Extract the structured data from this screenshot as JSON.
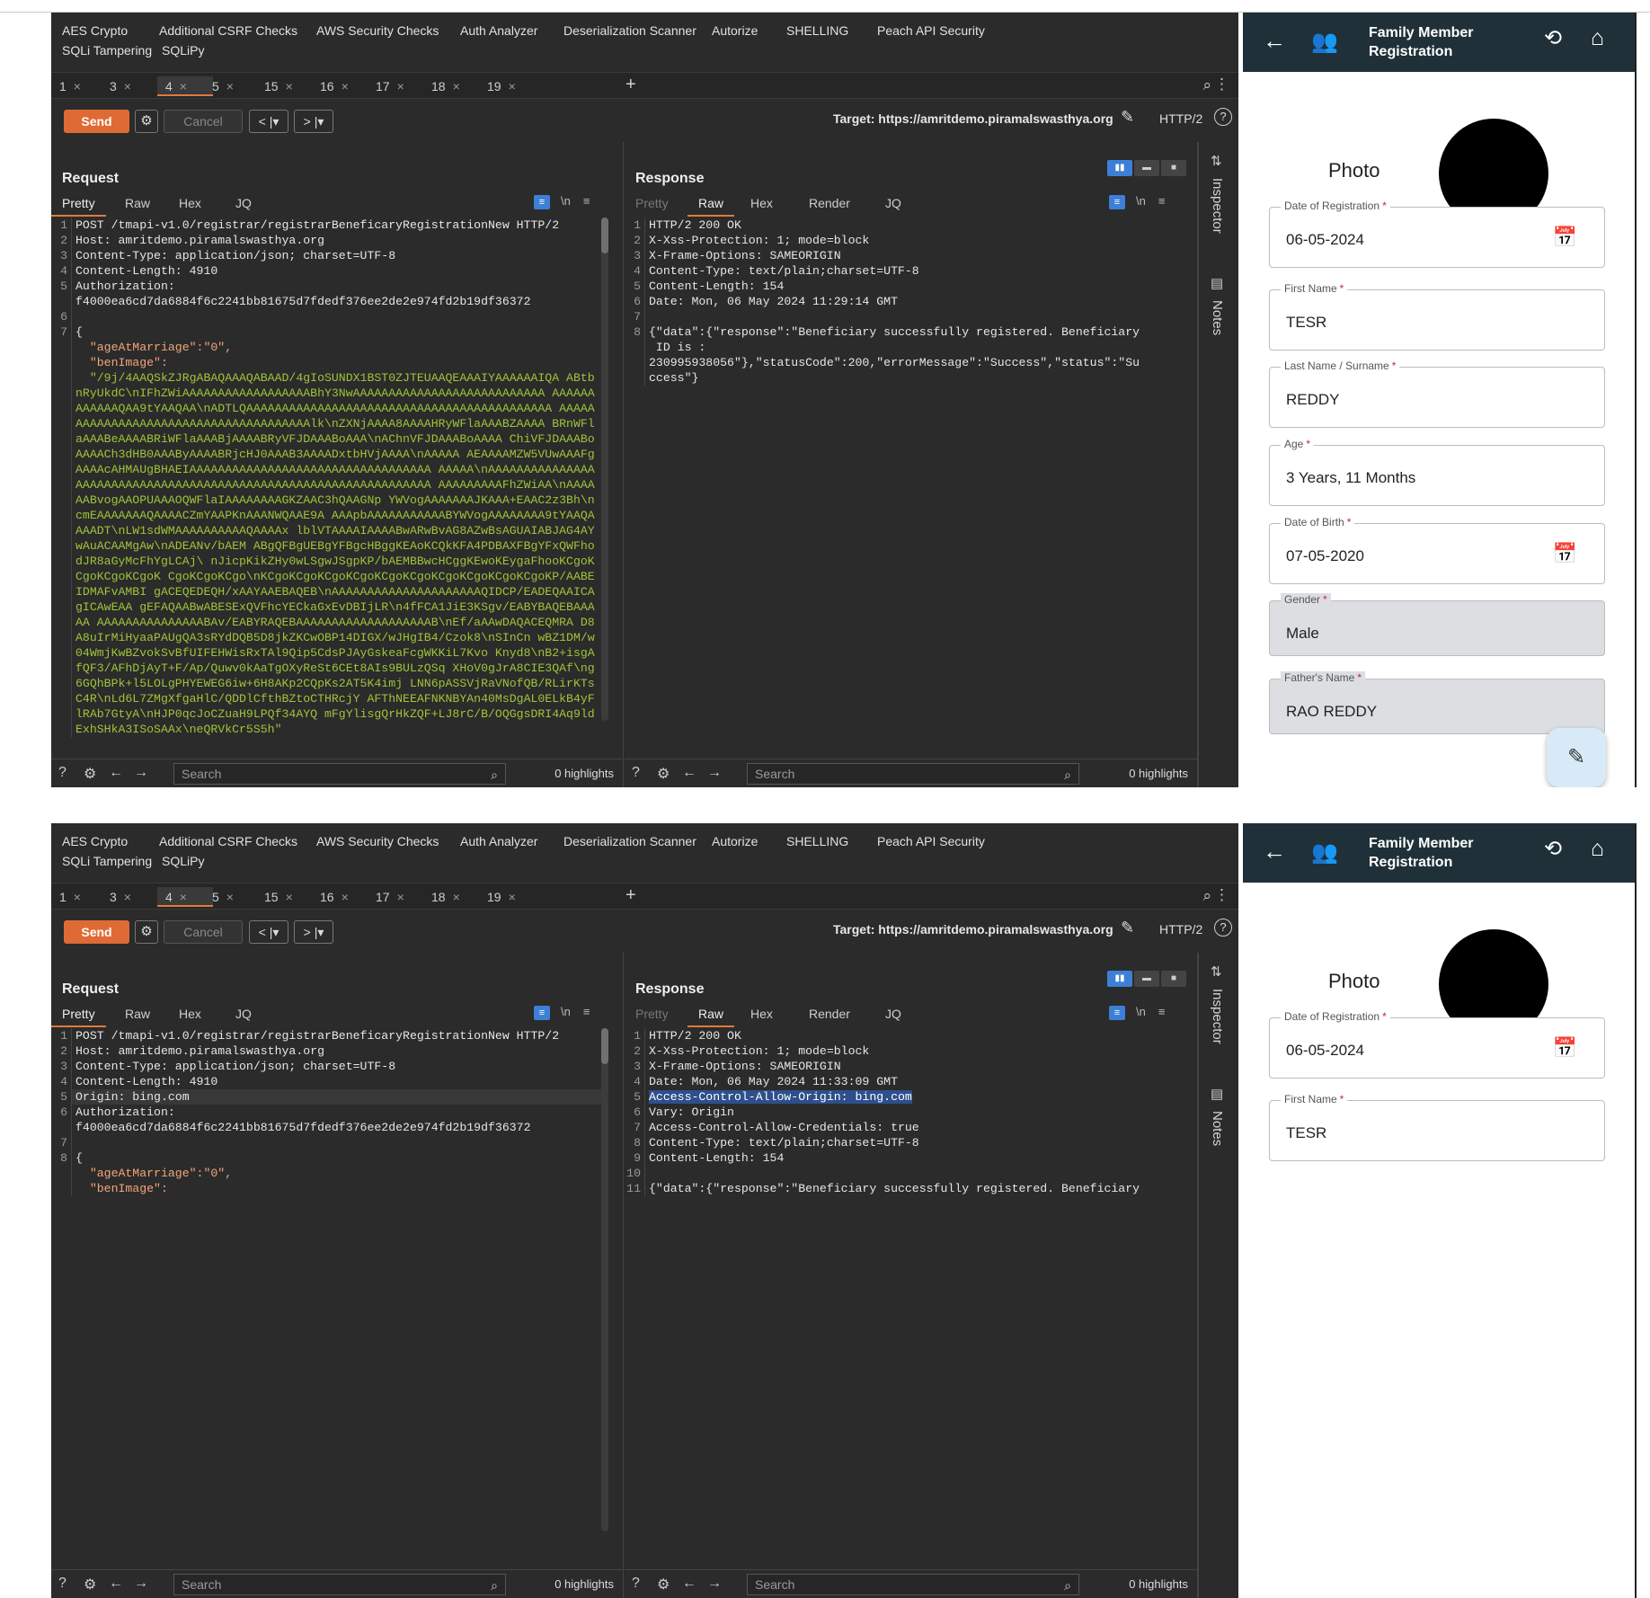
{
  "extensions": [
    "AES Crypto",
    "Additional CSRF Checks",
    "AWS Security Checks",
    "Auth Analyzer",
    "Deserialization Scanner",
    "Autorize",
    "SHELLING",
    "Peach API Security",
    "SQLi Tampering",
    "SQLiPy"
  ],
  "tabs": [
    {
      "label": "1",
      "close": "×"
    },
    {
      "label": "3",
      "close": "×"
    },
    {
      "label": "4",
      "close": "×"
    },
    {
      "label": "5",
      "close": "×"
    },
    {
      "label": "15",
      "close": "×"
    },
    {
      "label": "16",
      "close": "×"
    },
    {
      "label": "17",
      "close": "×"
    },
    {
      "label": "18",
      "close": "×"
    },
    {
      "label": "19",
      "close": "×"
    }
  ],
  "tab_plus": "+",
  "toolbar": {
    "send": "Send",
    "cancel": "Cancel",
    "back": "< |▾",
    "fwd": "> |▾",
    "target": "Target: https://amritdemo.piramalswasthya.org",
    "http": "HTTP/2",
    "help": "?"
  },
  "request": {
    "title": "Request",
    "subtabs": [
      "Pretty",
      "Raw",
      "Hex",
      "JQ"
    ],
    "newline": "\\n",
    "search_placeholder": "Search",
    "highlights": "0 highlights"
  },
  "response": {
    "title": "Response",
    "subtabs": [
      "Pretty",
      "Raw",
      "Hex",
      "Render",
      "JQ"
    ],
    "newline": "\\n",
    "search_placeholder": "Search",
    "highlights": "0 highlights"
  },
  "inspector": {
    "label": "Inspector",
    "notes": "Notes"
  },
  "shot1": {
    "request_lines": [
      {
        "n": "1",
        "t": "POST /tmapi-v1.0/registrar/registrarBeneficaryRegistrationNew HTTP/2"
      },
      {
        "n": "2",
        "t": "Host: amritdemo.piramalswasthya.org"
      },
      {
        "n": "3",
        "t": "Content-Type: application/json; charset=UTF-8"
      },
      {
        "n": "4",
        "t": "Content-Length: 4910"
      },
      {
        "n": "5",
        "t": "Authorization:\nf4000ea6cd7da6884f6c2241bb81675d7fdedf376ee2de2e974fd2b19df36372"
      },
      {
        "n": "6",
        "t": ""
      },
      {
        "n": "7",
        "t": "{"
      },
      {
        "n": "",
        "t": "  \"ageAtMarriage\":\"0\",",
        "c": "key"
      },
      {
        "n": "",
        "t": "  \"benImage\":",
        "c": "key"
      },
      {
        "n": "",
        "t": "  \"/9j/4AAQSkZJRgABAQAAAQABAAD/4gIoSUNDX1BST0ZJTEUAAQEAAAIYAAAAAAIQA ABtbnRyUkdC\\nIFhZWiAAAAAAAAAAAAAAAAAABhY3NwAAAAAAAAAAAAAAAAAAAAAAAAAAA AAAAAAAAAAAAQAA9tYAAQAA\\nADTLQAAAAAAAAAAAAAAAAAAAAAAAAAAAAAAAAAAAAAAAAAAA AAAAAAAAAAAAAAAAAAAAAAAAAAAAAAAAAAAAAAlk\\nZXNjAAAA8AAAAHRyWFlaAAABZAAAA BRnWFlaAAABeAAAABRiWFlaAAABjAAAABRyVFJDAAABoAAA\\nAChnVFJDAAABoAAAA ChiVFJDAAABoAAAACh3dHB0AAAByAAAABRjcHJ0AAAB3AAAADxtbHVjAAAA\\nAAAAA AEAAAAMZW5VUwAAAFgAAAAcAHMAUgBHAEIAAAAAAAAAAAAAAAAAAAAAAAAAAAAAAAAAA AAAAA\\nAAAAAAAAAAAAAAAAAAAAAAAAAAAAAAAAAAAAAAAAAAAAAAAAAAAAAAAAAAAAAAAAA AAAAAAAAAFhZWiAA\\nAAAAAABvogAAOPUAAAOQWFlaIAAAAAAAAGKZAAC3hQAAGNp YWVogAAAAAAAJKAAA+EAAC2z3Bh\\ncmEAAAAAAAQAAAACZmYAAPKnAAANWQAAE9A AAApbAAAAAAAAAAABYWVogAAAAAAAA9tYAAQAAAADT\\nLW1sdWMAAAAAAAAAAQAAAAx lblVTAAAAIAAAABwARwBvAG8AZwBsAGUAIABJAG4AYwAuACAAMgAw\\nADEANv/bAEM ABgQFBgUEBgYFBgcHBggKEAoKCQkKFA4PDBAXFBgYFxQWFhodJR8aGyMcFhYgLCAj\\ nJicpKikZHy0wLSgwJSgpKP/bAEMBBwcHCggKEwoKEygaFhooKCgoKCgoKCgoKCgoK CgoKCgoKCgo\\nKCgoKCgoKCgoKCgoKCgoKCgoKCgoKCgoKCgoKCgoKP/AABEIDMAFvAMBI gACEQEDEQH/xAAYAAEBAQEB\\nAAAAAAAAAAAAAAAAAAAAAQIDCP/EADEQAAICAgICAwEAA gEFAQAABwABESExQVFhcYECkaGxEvDBIjLR\\n4fFCA1JiE3KSgv/EABYBAQEBAAAAA AAAAAAAAAAAAAAABAv/EABYRAQEBAAAAAAAAAAAAAAAAAAAB\\nEf/aAAwDAQACEQMRA D8A8uIrMiHyaaPAUgQA3sRYdDQB5D8jkZKCwOBP14DIGX/wJHgIB4/Czok8\\nSInCn wBZ1DM/w04WmjKwBZvokSvBfUIFEHWisRxTAl9Qip5CdsPJAyGskeaFcgWKKiL7Kvo Knyd8\\nB2+isgAfQF3/AFhDjAyT+F/Ap/Quwv0kAaTgOXyReSt6CEt8AIs9BULzQSq XHoV0gJrA8CIE3QAf\\ng6GQhBPk+l5LOLgPHYEWEG6iw+6H8AKp2CQpKs2AT5K4imj LNN6pASSVjRaVNofQB/RLirKTsC4R\\nLd6L7ZMgXfgaHlC/QDDlCfthBZtoCTHRcjY AFThNEEAFNKNBYAn40MsDgAL0ELkB4yFlRAb7GtyA\\nHJP0qcJoCZuaH9LPQf34AYQ mFgYlisgQrHkZQF+LJ8rC/B/OQGgsDRI4Aq9ldExhSHkA3ISoSAAx\\neQRVkCr5S5h\"",
        "c": "val"
      }
    ],
    "response_lines": [
      {
        "n": "1",
        "t": "HTTP/2 200 OK"
      },
      {
        "n": "2",
        "t": "X-Xss-Protection: 1; mode=block"
      },
      {
        "n": "3",
        "t": "X-Frame-Options: SAMEORIGIN"
      },
      {
        "n": "4",
        "t": "Content-Type: text/plain;charset=UTF-8"
      },
      {
        "n": "5",
        "t": "Content-Length: 154"
      },
      {
        "n": "6",
        "t": "Date: Mon, 06 May 2024 11:29:14 GMT"
      },
      {
        "n": "7",
        "t": ""
      },
      {
        "n": "8",
        "t": "{\"data\":{\"response\":\"Beneficiary successfully registered. Beneficiary\n ID is :\n230995938056\"},\"statusCode\":200,\"errorMessage\":\"Success\",\"status\":\"Su\nccess\"}"
      }
    ]
  },
  "shot2": {
    "request_lines": [
      {
        "n": "1",
        "t": "POST /tmapi-v1.0/registrar/registrarBeneficaryRegistrationNew HTTP/2"
      },
      {
        "n": "2",
        "t": "Host: amritdemo.piramalswasthya.org"
      },
      {
        "n": "3",
        "t": "Content-Type: application/json; charset=UTF-8"
      },
      {
        "n": "4",
        "t": "Content-Length: 4910"
      },
      {
        "n": "5",
        "t": "Origin: bing.com",
        "c": "hl"
      },
      {
        "n": "6",
        "t": "Authorization:\nf4000ea6cd7da6884f6c2241bb81675d7fdedf376ee2de2e974fd2b19df36372"
      },
      {
        "n": "7",
        "t": ""
      },
      {
        "n": "8",
        "t": "{"
      },
      {
        "n": "",
        "t": "  \"ageAtMarriage\":\"0\",",
        "c": "key"
      },
      {
        "n": "",
        "t": "  \"benImage\":",
        "c": "key"
      }
    ],
    "response_lines": [
      {
        "n": "1",
        "t": "HTTP/2 200 OK"
      },
      {
        "n": "2",
        "t": "X-Xss-Protection: 1; mode=block"
      },
      {
        "n": "3",
        "t": "X-Frame-Options: SAMEORIGIN"
      },
      {
        "n": "4",
        "t": "Date: Mon, 06 May 2024 11:33:09 GMT"
      },
      {
        "n": "5",
        "t": "Access-Control-Allow-Origin: bing.com",
        "c": "sel"
      },
      {
        "n": "6",
        "t": "Vary: Origin"
      },
      {
        "n": "7",
        "t": "Access-Control-Allow-Credentials: true"
      },
      {
        "n": "8",
        "t": "Content-Type: text/plain;charset=UTF-8"
      },
      {
        "n": "9",
        "t": "Content-Length: 154"
      },
      {
        "n": "10",
        "t": ""
      },
      {
        "n": "11",
        "t": "{\"data\":{\"response\":\"Beneficiary successfully registered. Beneficiary"
      }
    ]
  },
  "mobile": {
    "title": "Family Member Registration",
    "photo_label": "Photo",
    "fields": [
      {
        "label": "Date of Registration",
        "value": "06-05-2024",
        "calendar": true,
        "disabled": false
      },
      {
        "label": "First Name",
        "value": "TESR",
        "calendar": false,
        "disabled": false
      },
      {
        "label": "Last Name / Surname",
        "value": "REDDY",
        "calendar": false,
        "disabled": false
      },
      {
        "label": "Age",
        "value": "3 Years, 11 Months",
        "calendar": false,
        "disabled": false
      },
      {
        "label": "Date of Birth",
        "value": "07-05-2020",
        "calendar": true,
        "disabled": false
      },
      {
        "label": "Gender",
        "value": "Male",
        "calendar": false,
        "disabled": true
      },
      {
        "label": "Father's Name",
        "value": "RAO REDDY",
        "calendar": false,
        "disabled": true
      }
    ],
    "required_mark": "*"
  },
  "colors": {
    "send": "#e06a35",
    "accent_tab": "#e07b3a",
    "selection": "#2e4f8c",
    "mobile_header": "#1f3038",
    "json_key": "#f5a57a",
    "json_value": "#9fc43a"
  }
}
